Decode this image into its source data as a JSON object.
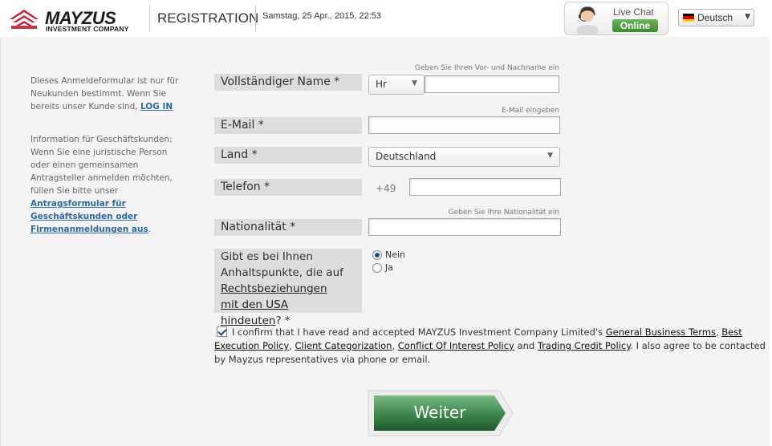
{
  "header": {
    "logo_text": "MAYZUS",
    "logo_subtitle": "INVESTMENT COMPANY",
    "title": "REGISTRATION",
    "datetime": "Samstag, 25 Apr., 2015, 22:53",
    "live_chat_label": "Live Chat",
    "live_chat_status": "Online",
    "language": "Deutsch"
  },
  "sidebar": {
    "intro_text": "Dieses Anmeldeformular ist nur für Neukunden bestimmt. Wenn Sie bereits unser Kunde sind,",
    "login_link": "LOG IN",
    "business_text": "Information für Geschäftskunden: Wenn Sie eine juristische Person oder einen gemeinsamen Antragsteller anmelden möchten, füllen Sie bitte unser",
    "business_link": "Antragsformular für Geschäftskunden oder Firmenanmeldungen aus",
    "business_end": "."
  },
  "form": {
    "name": {
      "label": "Vollständiger Name *",
      "hint": "Geben Sie Ihren Vor- und Nachname ein",
      "salutation": "Hr",
      "value": ""
    },
    "email": {
      "label": "E-Mail *",
      "hint": "E-Mail eingeben",
      "value": ""
    },
    "country": {
      "label": "Land *",
      "value": "Deutschland"
    },
    "phone": {
      "label": "Telefon *",
      "prefix": "+49",
      "value": ""
    },
    "nationality": {
      "label": "Nationalität *",
      "hint": "Geben Sie Ihre Nationalität ein",
      "value": ""
    },
    "us_question": {
      "label_pre": "Gibt es bei Ihnen Anhaltspunkte, die auf",
      "label_link": "Rechtsbeziehungen mit den USA hindeuten",
      "label_post": "? *",
      "options": [
        "Nein",
        "Ja"
      ],
      "selected": "Nein"
    },
    "confirm": {
      "checked": true,
      "text_1": "I confirm that I have read and accepted MAYZUS Investment Company Limited's",
      "link_1": "General Business Terms",
      "sep_1": ",",
      "link_2": "Best Execution Policy",
      "sep_2": ",",
      "link_3": "Client Categorization",
      "sep_3": ",",
      "link_4": "Conflict Of Interest Policy",
      "sep_4": "and",
      "link_5": "Trading Credit Policy",
      "text_2": ". I also agree to be contacted by Mayzus representatives via phone or email."
    },
    "submit_label": "Weiter"
  },
  "colors": {
    "accent_red": "#c8202f",
    "button_green": "#3f8a4f",
    "link_blue": "#2a6aa6",
    "label_bg": "#dddddd",
    "online_green": "#4a9a3c"
  }
}
